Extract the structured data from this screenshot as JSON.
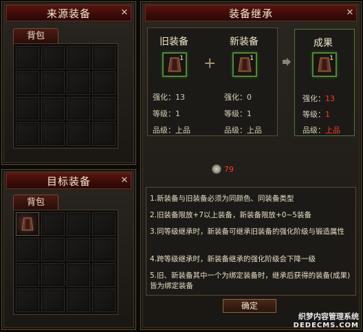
{
  "source_panel": {
    "title": "来源装备",
    "tab_label": "背包",
    "cells": [
      false,
      false,
      false,
      false,
      false,
      false,
      false,
      false,
      false,
      false,
      false,
      false,
      false,
      false,
      false,
      false
    ]
  },
  "target_panel": {
    "title": "目标装备",
    "tab_label": "背包",
    "cells": [
      true,
      false,
      false,
      false,
      false,
      false,
      false,
      false,
      false,
      false,
      false,
      false,
      false,
      false,
      false,
      false
    ]
  },
  "inherit_panel": {
    "title": "装备继承",
    "old_equip": {
      "header": "旧装备",
      "count": "1",
      "enhance": "强化：13",
      "level": "等级：1",
      "grade": "品级：上品"
    },
    "new_equip": {
      "header": "新装备",
      "count": "1",
      "enhance": "强化：0",
      "level": "等级：1",
      "grade": "品级：上品"
    },
    "plus_symbol": "+",
    "result": {
      "header": "成果",
      "count": "1",
      "enhance_label": "强化：",
      "enhance_value": "13",
      "level_label": "等级：",
      "level_value": "1",
      "grade_label": "品级：",
      "grade_value": "上品"
    },
    "cost_value": "79",
    "notes": [
      "1.新装备与旧装备必须为同颜色、同装备类型",
      "2.旧装备限放+7以上装备，新装备限放+0~5装备",
      "3.同等级继承时，新装备可继承旧装备的强化阶级与锻造属性",
      "4.跨等级继承时，新装备继承的强化阶级会下降一级",
      "5.旧、新装备其中一个为绑定装备时，继承后获得的装备(成果)皆为绑定装备"
    ],
    "confirm_label": "确定"
  },
  "watermark": {
    "line1": "织梦内容管理系统",
    "line2": "DEDECMS.COM"
  },
  "colors": {
    "title_red": "#5a1410",
    "slot_green": "#4d8a3a",
    "highlight_red": "#ff3a2a"
  }
}
